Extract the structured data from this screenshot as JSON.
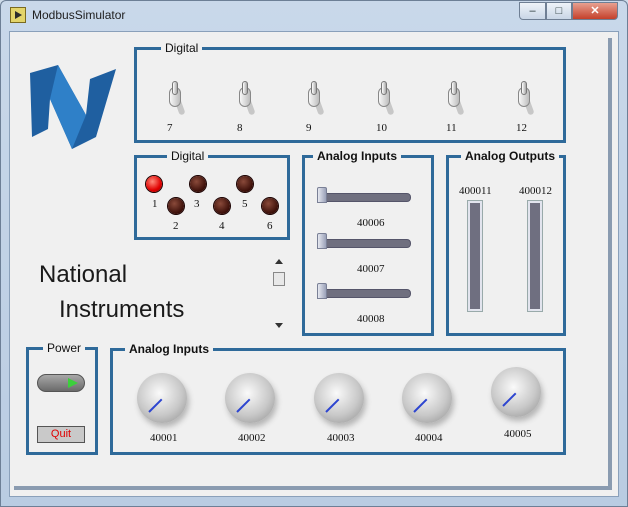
{
  "window": {
    "title": "ModbusSimulator"
  },
  "digital_toggles": {
    "label": "Digital",
    "items": [
      "7",
      "8",
      "9",
      "10",
      "11",
      "12"
    ]
  },
  "digital_leds": {
    "label": "Digital",
    "items": [
      {
        "id": "1",
        "on": true
      },
      {
        "id": "2",
        "on": false
      },
      {
        "id": "3",
        "on": false
      },
      {
        "id": "4",
        "on": false
      },
      {
        "id": "5",
        "on": false
      },
      {
        "id": "6",
        "on": false
      }
    ]
  },
  "analog_inputs_sliders": {
    "label": "Analog Inputs",
    "items": [
      "40006",
      "40007",
      "40008"
    ]
  },
  "analog_outputs": {
    "label": "Analog Outputs",
    "items": [
      "400011",
      "400012"
    ]
  },
  "brand_text": {
    "line1": "National",
    "line2": "Instruments"
  },
  "power": {
    "label": "Power",
    "quit_label": "Quit"
  },
  "analog_inputs_knobs": {
    "label": "Analog Inputs",
    "items": [
      "40001",
      "40002",
      "40003",
      "40004",
      "40005"
    ]
  },
  "colors": {
    "frame": "#2f6a9a",
    "led_on": "#e00000",
    "led_off": "#3a0e08",
    "power_arrow": "#3cd03c",
    "knob_pointer": "#2d45d0"
  },
  "icons": [
    "app-icon",
    "minimize-icon",
    "maximize-icon",
    "close-icon",
    "ni-logo-icon"
  ]
}
